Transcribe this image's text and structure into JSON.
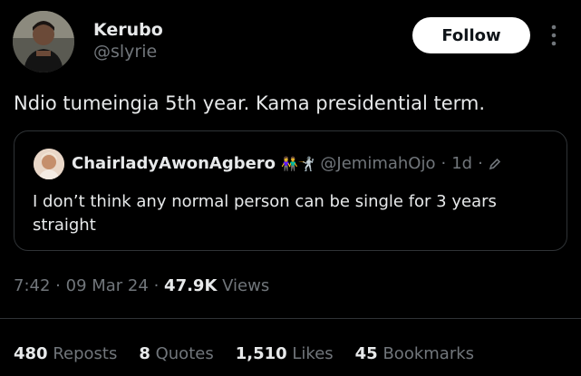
{
  "author": {
    "name": "Kerubo",
    "handle": "@slyrie",
    "avatar_icon": "profile-photo"
  },
  "follow_label": "Follow",
  "tweet_text": "Ndio tumeingia 5th year. Kama presidential term.",
  "quoted": {
    "name": "ChairladyAwonAgbero",
    "emojis": "👫🤺",
    "handle": "@JemimahOjo",
    "dot": "·",
    "time": "1d",
    "text": "I don’t think any normal person can be single for 3 years straight"
  },
  "meta": {
    "time": "7:42",
    "date": "09 Mar 24",
    "views": "47.9K",
    "views_label": "Views",
    "sep": "·"
  },
  "stats": [
    {
      "count": "480",
      "label": "Reposts"
    },
    {
      "count": "8",
      "label": "Quotes"
    },
    {
      "count": "1,510",
      "label": "Likes"
    },
    {
      "count": "45",
      "label": "Bookmarks"
    }
  ],
  "colors": {
    "background": "#000000",
    "text_primary": "#e7e9ea",
    "text_secondary": "#71767b",
    "border": "#2f3336",
    "follow_bg": "#ffffff"
  }
}
